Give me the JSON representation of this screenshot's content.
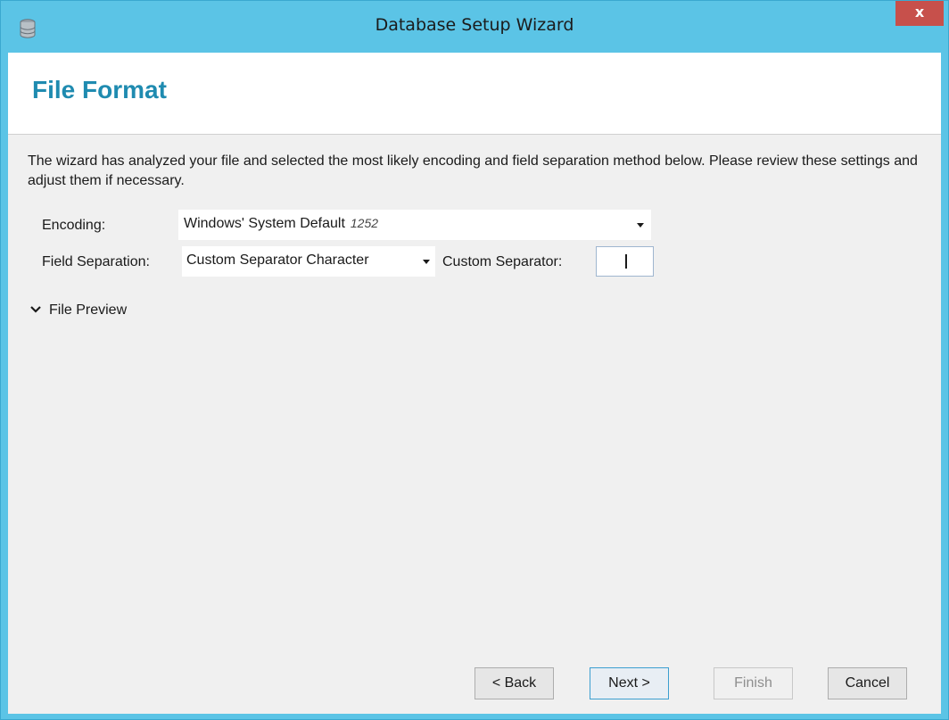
{
  "window": {
    "title": "Database Setup Wizard",
    "close_label": "x"
  },
  "page": {
    "title": "File Format",
    "intro": "The wizard has analyzed your file and selected the most likely encoding and field separation method below.  Please review these settings and adjust them if necessary."
  },
  "encoding": {
    "label": "Encoding:",
    "value": "Windows' System Default",
    "codepage": "1252"
  },
  "field_separation": {
    "label": "Field Separation:",
    "value": "Custom Separator Character",
    "custom_label": "Custom Separator:",
    "custom_value": ""
  },
  "preview": {
    "label": "File Preview",
    "expanded": false
  },
  "buttons": {
    "back": "< Back",
    "next": "Next >",
    "finish": "Finish",
    "cancel": "Cancel"
  },
  "colors": {
    "title_bar": "#5bc4e6",
    "accent_title": "#1f8bb0",
    "close": "#c7504b"
  }
}
